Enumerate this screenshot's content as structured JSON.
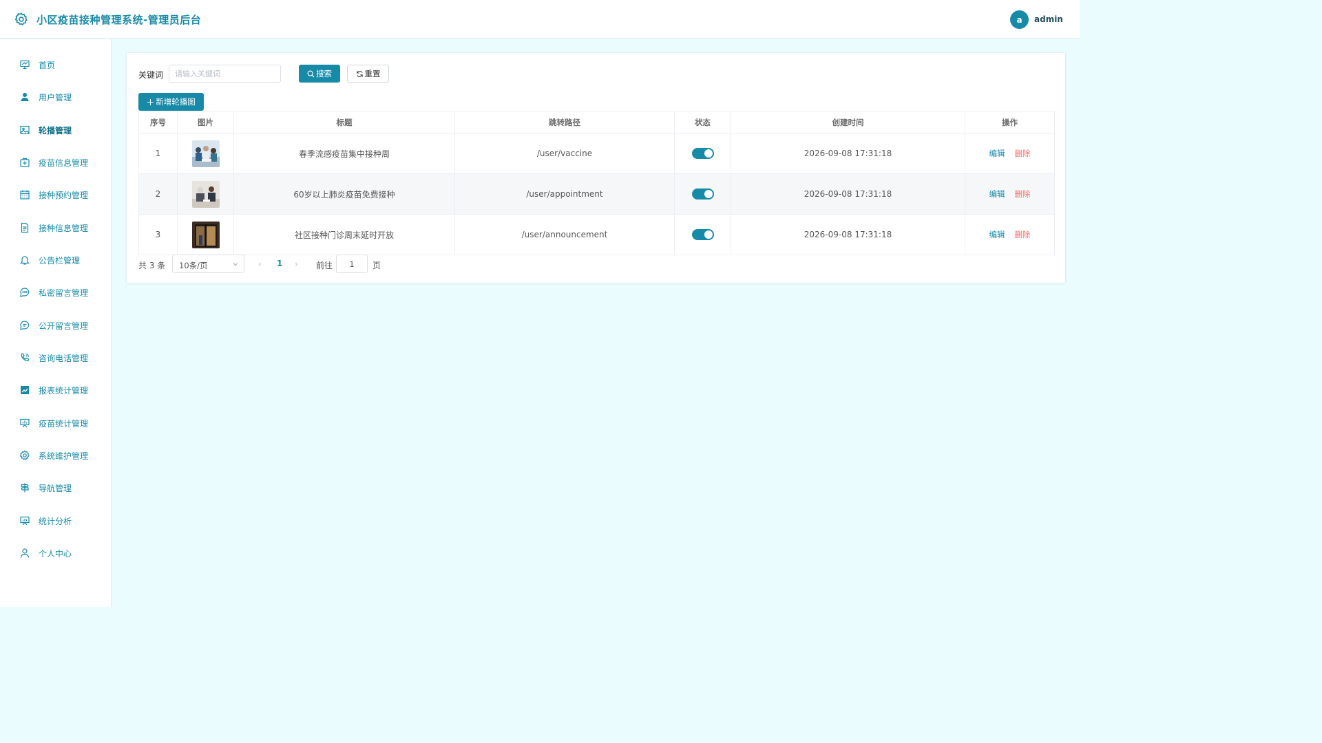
{
  "header": {
    "title": "小区疫苗接种管理系统-管理员后台",
    "avatar_letter": "a",
    "username": "admin"
  },
  "sidebar": {
    "active": "轮播管理",
    "items": [
      {
        "label": "首页",
        "icon": "presentation-icon"
      },
      {
        "label": "用户管理",
        "icon": "user-icon"
      },
      {
        "label": "轮播管理",
        "icon": "image-icon"
      },
      {
        "label": "疫苗信息管理",
        "icon": "medical-box-icon"
      },
      {
        "label": "接种预约管理",
        "icon": "calendar-icon"
      },
      {
        "label": "接种信息管理",
        "icon": "document-icon"
      },
      {
        "label": "公告栏管理",
        "icon": "bell-icon"
      },
      {
        "label": "私密留言管理",
        "icon": "chat-dots-icon"
      },
      {
        "label": "公开留言管理",
        "icon": "chat-lines-icon"
      },
      {
        "label": "咨询电话管理",
        "icon": "phone-icon"
      },
      {
        "label": "报表统计管理",
        "icon": "data-line-icon"
      },
      {
        "label": "疫苗统计管理",
        "icon": "data-board-icon"
      },
      {
        "label": "系统维护管理",
        "icon": "gear-icon"
      },
      {
        "label": "导航管理",
        "icon": "guide-icon"
      },
      {
        "label": "统计分析",
        "icon": "data-analysis-icon"
      },
      {
        "label": "个人中心",
        "icon": "user-outline-icon"
      }
    ]
  },
  "search": {
    "label": "关键词",
    "placeholder": "请输入关键词",
    "search_button": "搜索",
    "reset_button": "重置",
    "add_button": "新增轮播图"
  },
  "table": {
    "columns": [
      "序号",
      "图片",
      "标题",
      "跳转路径",
      "状态",
      "创建时间",
      "操作"
    ],
    "rows": [
      {
        "index": "1",
        "title": "春季流感疫苗集中接种周",
        "path": "/user/vaccine",
        "status_on": true,
        "created": "2026-09-08 17:31:18",
        "image": "crowd-vaccination-photo"
      },
      {
        "index": "2",
        "title": "60岁以上肺炎疫苗免费接种",
        "path": "/user/appointment",
        "status_on": true,
        "created": "2026-09-08 17:31:18",
        "image": "elderly-consultation-photo"
      },
      {
        "index": "3",
        "title": "社区接种门诊周末延时开放",
        "path": "/user/announcement",
        "status_on": true,
        "created": "2026-09-08 17:31:18",
        "image": "clinic-entrance-photo"
      }
    ],
    "edit_label": "编辑",
    "delete_label": "删除"
  },
  "pagination": {
    "total_text": "共 3 条",
    "page_size": "10条/页",
    "current_page": "1",
    "goto_label": "前往",
    "goto_value": "1",
    "page_suffix": "页"
  },
  "colors": {
    "primary": "#178aa8",
    "danger": "#f56c6c",
    "background": "#ebfcfe"
  }
}
